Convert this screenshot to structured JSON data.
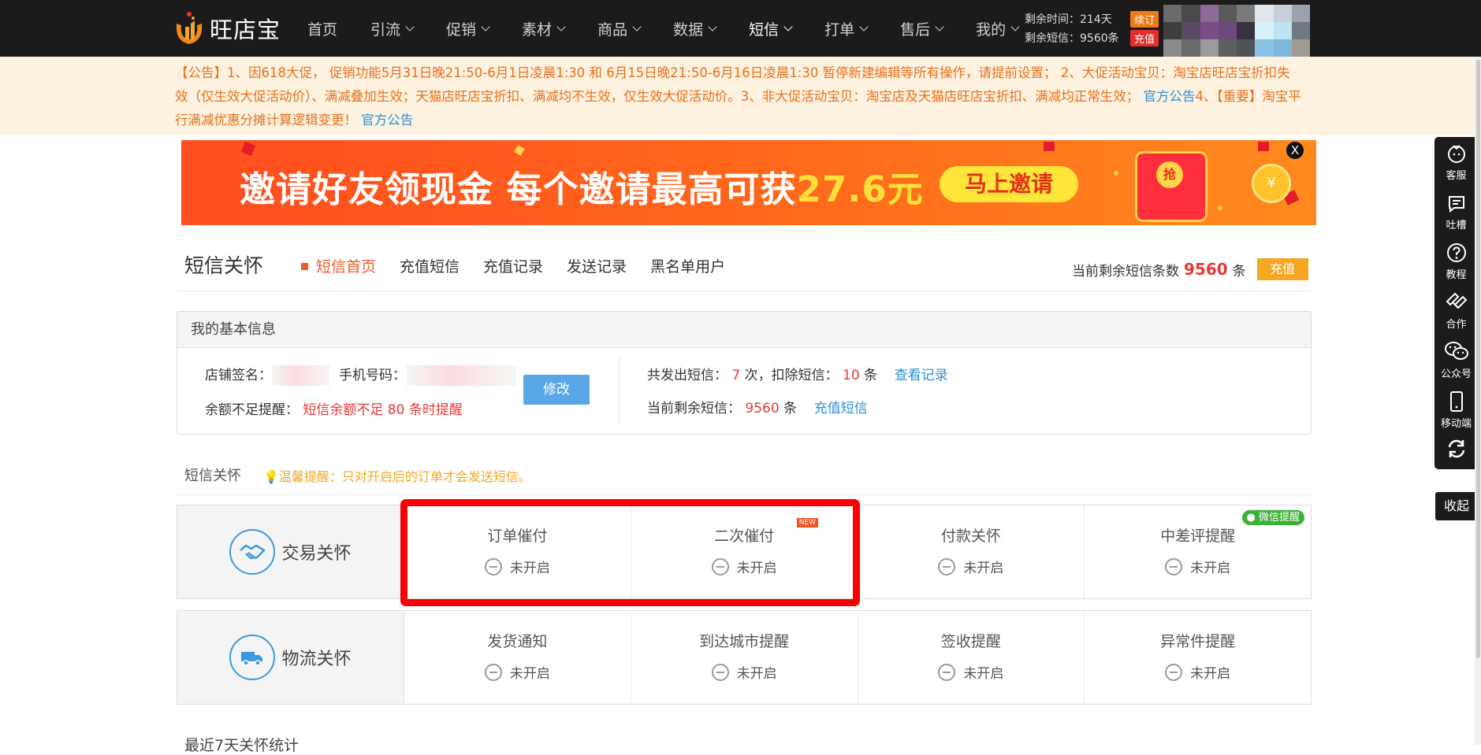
{
  "app": {
    "name": "旺店宝"
  },
  "nav": {
    "items": [
      {
        "label": "首页",
        "has_dropdown": false,
        "active": false
      },
      {
        "label": "引流",
        "has_dropdown": true,
        "active": false
      },
      {
        "label": "促销",
        "has_dropdown": true,
        "active": false
      },
      {
        "label": "素材",
        "has_dropdown": true,
        "active": false
      },
      {
        "label": "商品",
        "has_dropdown": true,
        "active": false
      },
      {
        "label": "数据",
        "has_dropdown": true,
        "active": false
      },
      {
        "label": "短信",
        "has_dropdown": true,
        "active": true
      },
      {
        "label": "打单",
        "has_dropdown": true,
        "active": false
      },
      {
        "label": "售后",
        "has_dropdown": true,
        "active": false
      },
      {
        "label": "我的",
        "has_dropdown": true,
        "active": false
      }
    ]
  },
  "account": {
    "time_left": "剩余时间：214天",
    "renew_label": "续订",
    "sms_left": "剩余短信：9560条",
    "recharge_label": "充值"
  },
  "notice": {
    "part1": "【公告】1、因618大促， 促销功能5月31日晚21:50-6月1日凌晨1:30 和 6月15日晚21:50-6月16日凌晨1:30 暂停新建编辑等所有操作，请提前设置； 2、大促活动宝贝：淘宝店旺店宝折扣失效（仅生效大促活动价）、满减叠加生效；天猫店旺店宝折扣、满减均不生效，仅生效大促活动价。3、非大促活动宝贝：淘宝店及天猫店旺店宝折扣、满减均正常生效； ",
    "link1": "官方公告",
    "part2": "4、【重要】淘宝平行满减优惠分摊计算逻辑变更！ ",
    "link2": "官方公告"
  },
  "banner": {
    "text": "邀请好友领现金 每个邀请最高可获",
    "amount": "27.6元",
    "button": "马上邀请",
    "envelope_char": "抢",
    "close": "X"
  },
  "page": {
    "title": "短信关怀",
    "tabs": [
      {
        "label": "短信首页",
        "active": true
      },
      {
        "label": "充值短信",
        "active": false
      },
      {
        "label": "充值记录",
        "active": false
      },
      {
        "label": "发送记录",
        "active": false
      },
      {
        "label": "黑名单用户",
        "active": false
      }
    ],
    "remain_label": "当前剩余短信条数",
    "remain_value": "9560",
    "remain_unit": "条",
    "recharge_button": "充值"
  },
  "basic_info": {
    "title": "我的基本信息",
    "shop_sig_label": "店铺签名：",
    "phone_label": "手机号码：",
    "edit_button": "修改",
    "low_balance_label": "余额不足提醒：",
    "low_balance_value": "短信余额不足 80 条时提醒",
    "sent_label": "共发出短信：",
    "sent_count": "7",
    "sent_unit": "次，扣除短信：",
    "deducted": "10",
    "deducted_unit": "条",
    "view_records": "查看记录",
    "current_label": "当前剩余短信：",
    "current_value": "9560",
    "current_unit": "条",
    "recharge_link": "充值短信"
  },
  "care": {
    "title": "短信关怀",
    "tip": "温馨提醒：只对开启后的订单才会发送短信。",
    "rows": [
      {
        "label": "交易关怀",
        "icon": "handshake-icon",
        "items": [
          {
            "title": "订单催付",
            "status": "未开启"
          },
          {
            "title": "二次催付",
            "status": "未开启",
            "badge": "NEW"
          },
          {
            "title": "付款关怀",
            "status": "未开启"
          },
          {
            "title": "中差评提醒",
            "status": "未开启",
            "badge": "微信提醒"
          }
        ]
      },
      {
        "label": "物流关怀",
        "icon": "truck-icon",
        "items": [
          {
            "title": "发货通知",
            "status": "未开启"
          },
          {
            "title": "到达城市提醒",
            "status": "未开启"
          },
          {
            "title": "签收提醒",
            "status": "未开启"
          },
          {
            "title": "异常件提醒",
            "status": "未开启"
          }
        ]
      }
    ]
  },
  "stats": {
    "title": "最近7天关怀统计"
  },
  "sidebar": {
    "items": [
      {
        "label": "客服",
        "icon": "customer-service-icon"
      },
      {
        "label": "吐槽",
        "icon": "feedback-icon"
      },
      {
        "label": "教程",
        "icon": "help-icon"
      },
      {
        "label": "合作",
        "icon": "cooperation-icon"
      },
      {
        "label": "公众号",
        "icon": "wechat-icon"
      },
      {
        "label": "移动端",
        "icon": "mobile-icon"
      }
    ],
    "collapse": "收起"
  },
  "colors": {
    "topbar": "#1b1b1b",
    "accent_orange": "#f05a28",
    "notice_bg": "#fdf1df",
    "notice_text": "#e8721c",
    "link_blue": "#2c8fd6",
    "highlight_red": "#fb0007"
  }
}
